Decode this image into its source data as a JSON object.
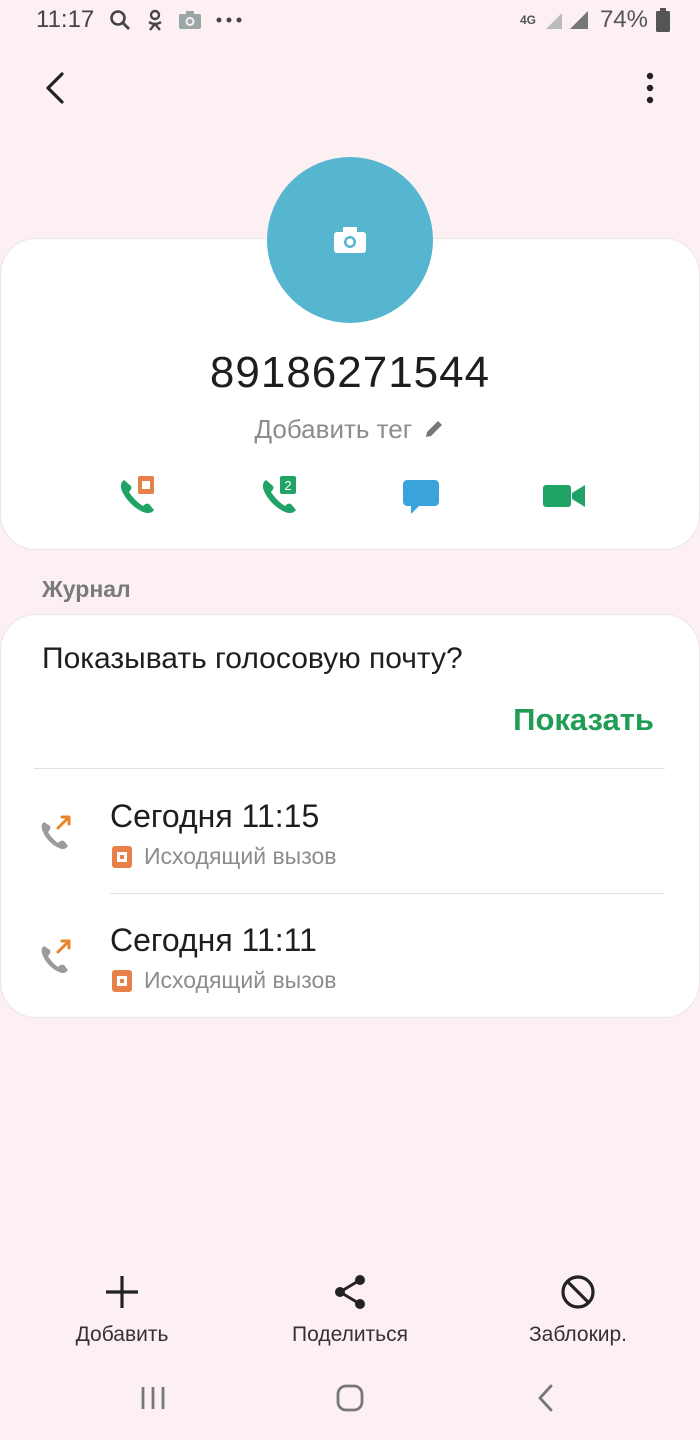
{
  "status_bar": {
    "time": "11:17",
    "network": "4G",
    "battery": "74%",
    "icons": [
      "search-icon",
      "ok-icon",
      "camera-icon",
      "more-dots-icon",
      "signal-icon",
      "battery-icon"
    ]
  },
  "contact": {
    "phone": "89186271544",
    "add_tag": "Добавить тег",
    "avatar_color": "#56b5cf",
    "actions": [
      "call-sim1-icon",
      "call-sim2-icon",
      "message-icon",
      "video-call-icon"
    ],
    "sim2_badge": "2"
  },
  "journal": {
    "label": "Журнал",
    "voicemail_question": "Показывать голосовую почту?",
    "voicemail_show": "Показать",
    "calls": [
      {
        "time": "Сегодня 11:15",
        "type": "Исходящий вызов"
      },
      {
        "time": "Сегодня 11:11",
        "type": "Исходящий вызов"
      }
    ]
  },
  "bottom_actions": {
    "add": "Добавить",
    "share": "Поделиться",
    "block": "Заблокир."
  },
  "colors": {
    "accent_green": "#1f9d55",
    "call_green": "#21a366",
    "message_blue": "#3aa3db",
    "sim_orange": "#e8804a",
    "background": "#fcf0f3"
  }
}
